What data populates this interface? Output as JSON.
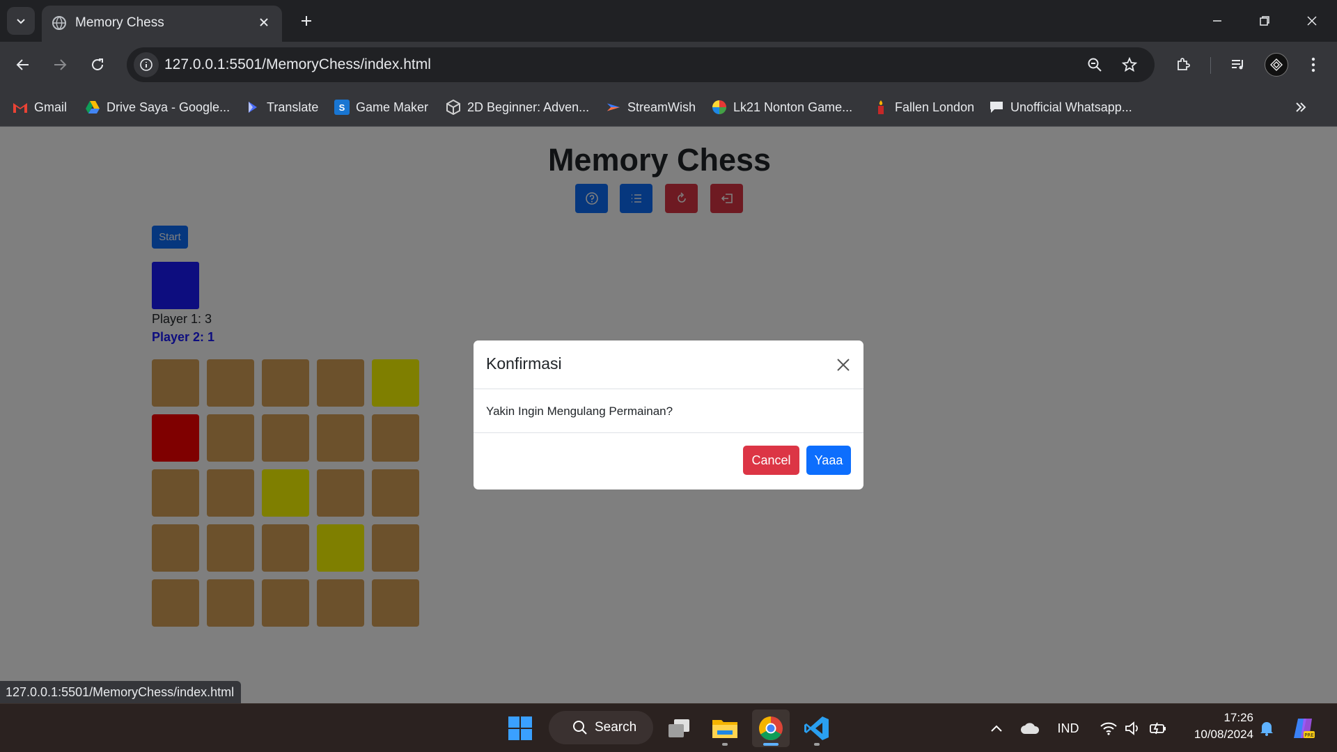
{
  "browser": {
    "tab_title": "Memory Chess",
    "url": "127.0.0.1:5501/MemoryChess/index.html",
    "bookmarks": [
      {
        "label": "Gmail",
        "icon": "gmail-icon"
      },
      {
        "label": "Drive Saya - Google...",
        "icon": "drive-icon"
      },
      {
        "label": "Translate",
        "icon": "translate-icon"
      },
      {
        "label": "Game Maker",
        "icon": "gamemaker-icon"
      },
      {
        "label": "2D Beginner: Adven...",
        "icon": "unity-icon"
      },
      {
        "label": "StreamWish",
        "icon": "streamwish-icon"
      },
      {
        "label": "Lk21 Nonton Game...",
        "icon": "lk21-icon"
      },
      {
        "label": "Fallen London",
        "icon": "candle-icon"
      },
      {
        "label": "Unofficial Whatsapp...",
        "icon": "chat-icon"
      }
    ],
    "status_url": "127.0.0.1:5501/MemoryChess/index.html"
  },
  "game": {
    "title": "Memory Chess",
    "controls": [
      {
        "name": "help",
        "icon": "help-icon",
        "color": "#0d6efd"
      },
      {
        "name": "list",
        "icon": "list-icon",
        "color": "#0d6efd"
      },
      {
        "name": "restart",
        "icon": "restart-icon",
        "color": "#dc3545"
      },
      {
        "name": "exit",
        "icon": "exit-icon",
        "color": "#dc3545"
      }
    ],
    "start_label": "Start",
    "turn_color": "#1a1aff",
    "player1_score": "Player 1: 3",
    "player2_score": "Player 2: 1",
    "board": [
      [
        "brown",
        "brown",
        "brown",
        "brown",
        "yellow"
      ],
      [
        "red",
        "brown",
        "brown",
        "brown",
        "brown"
      ],
      [
        "brown",
        "brown",
        "yellow",
        "brown",
        "brown"
      ],
      [
        "brown",
        "brown",
        "brown",
        "yellow",
        "brown"
      ],
      [
        "brown",
        "brown",
        "brown",
        "brown",
        "brown"
      ]
    ]
  },
  "modal": {
    "title": "Konfirmasi",
    "message": "Yakin Ingin Mengulang Permainan?",
    "cancel_label": "Cancel",
    "confirm_label": "Yaaa"
  },
  "taskbar": {
    "search_label": "Search",
    "language": "IND",
    "time": "17:26",
    "date": "10/08/2024"
  }
}
